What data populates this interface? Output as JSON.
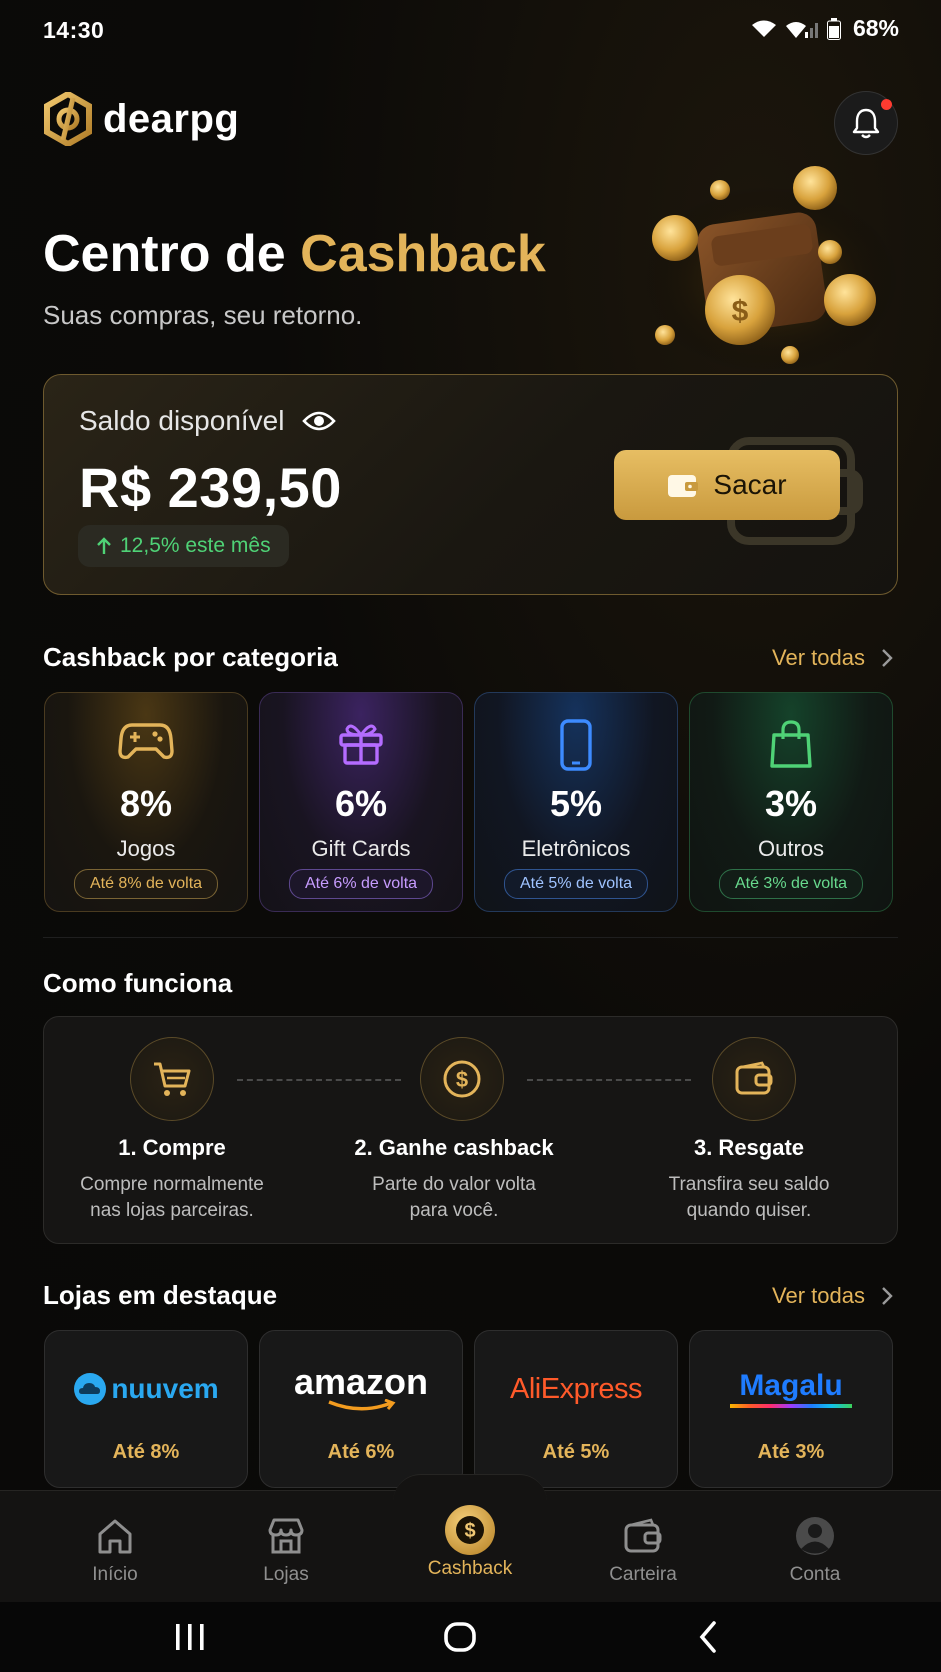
{
  "status_bar": {
    "time": "14:30",
    "battery": "68%"
  },
  "brand": {
    "name": "dearpg"
  },
  "hero": {
    "title_prefix": "Centro de ",
    "title_highlight": "Cashback",
    "subtitle": "Suas compras, seu retorno."
  },
  "balance": {
    "label": "Saldo disponível",
    "amount": "R$ 239,50",
    "growth": "12,5% este mês",
    "withdraw_label": "Sacar"
  },
  "categories": {
    "title": "Cashback por categoria",
    "see_all": "Ver todas",
    "items": [
      {
        "percent": "8%",
        "name": "Jogos",
        "badge": "Até 8% de volta",
        "icon": "gamepad-icon",
        "color": "#e3b45a"
      },
      {
        "percent": "6%",
        "name": "Gift Cards",
        "badge": "Até 6% de volta",
        "icon": "gift-icon",
        "color": "#b46cff"
      },
      {
        "percent": "5%",
        "name": "Eletrônicos",
        "badge": "Até 5% de volta",
        "icon": "smartphone-icon",
        "color": "#3d8bff"
      },
      {
        "percent": "3%",
        "name": "Outros",
        "badge": "Até 3% de volta",
        "icon": "shopping-bag-icon",
        "color": "#4fd276"
      }
    ]
  },
  "how_it_works": {
    "title": "Como funciona",
    "steps": [
      {
        "title": "1. Compre",
        "desc_1": "Compre normalmente",
        "desc_2": "nas lojas parceiras.",
        "icon": "cart-icon"
      },
      {
        "title": "2. Ganhe cashback",
        "desc_1": "Parte do valor volta",
        "desc_2": "para você.",
        "icon": "dollar-coin-icon"
      },
      {
        "title": "3. Resgate",
        "desc_1": "Transfira seu saldo",
        "desc_2": "quando quiser.",
        "icon": "wallet-icon"
      }
    ]
  },
  "stores": {
    "title": "Lojas em destaque",
    "see_all": "Ver todas",
    "items": [
      {
        "name": "nuuvem",
        "rate": "Até 8%"
      },
      {
        "name": "amazon",
        "rate": "Até 6%"
      },
      {
        "name": "AliExpress",
        "rate": "Até 5%"
      },
      {
        "name": "Magalu",
        "rate": "Até 3%"
      }
    ]
  },
  "bottom_nav": {
    "items": [
      {
        "label": "Início",
        "icon": "home-icon"
      },
      {
        "label": "Lojas",
        "icon": "store-icon"
      },
      {
        "label": "Cashback",
        "icon": "cashback-coin-icon",
        "active": true
      },
      {
        "label": "Carteira",
        "icon": "wallet-icon"
      },
      {
        "label": "Conta",
        "icon": "user-avatar-icon"
      }
    ]
  },
  "colors": {
    "accent": "#e3b45a",
    "background": "#0b0a08",
    "positive": "#4fd276"
  }
}
